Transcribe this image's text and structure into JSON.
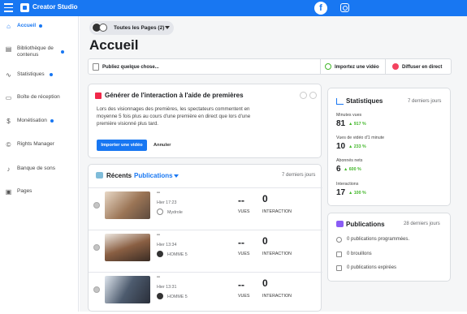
{
  "app": {
    "title": "Creator Studio"
  },
  "sidebar": {
    "items": [
      {
        "label": "Accueil"
      },
      {
        "label1": "Bibliothèque de",
        "label2": "contenus"
      },
      {
        "label": "Statistiques"
      },
      {
        "label": "Boîte de réception"
      },
      {
        "label": "Monétisation"
      },
      {
        "label": "Rights Manager"
      },
      {
        "label": "Banque de sons"
      },
      {
        "label": "Pages"
      }
    ]
  },
  "page_selector": {
    "label": "Toutes les Pages (2)"
  },
  "heading": "Accueil",
  "actions": {
    "publish": "Publiez quelque chose...",
    "import": "Importez une vidéo",
    "live": "Diffuser en direct"
  },
  "premiere": {
    "title": "Générer de l'interaction à l'aide de premières",
    "body": "Lors des visionnages des premières, les spectateurs commentent en moyenne 5 fois plus au cours d'une première en direct que lors d'une première visionné plus tard.",
    "primary": "Importer une vidéo",
    "secondary": "Annuler"
  },
  "recent": {
    "title": "Récents",
    "filter": "Publications",
    "period": "7 derniers jours",
    "rows": [
      {
        "dash": "--",
        "time": "Hier 17:23",
        "author": "Mydrole",
        "views": "--",
        "views_label": "VUES",
        "inter": "0",
        "inter_label": "INTERACTION",
        "thumb": "#c9a78a"
      },
      {
        "dash": "--",
        "time": "Hier 13:34",
        "author": "HOMME 5",
        "views": "--",
        "views_label": "VUES",
        "inter": "0",
        "inter_label": "INTERACTION",
        "thumb": "#8d6a52"
      },
      {
        "dash": "--",
        "time": "Hier 13:31",
        "author": "HOMME 5",
        "views": "--",
        "views_label": "VUES",
        "inter": "0",
        "inter_label": "INTERACTION",
        "thumb": "#6f7a8c"
      }
    ]
  },
  "stats": {
    "title": "Statistiques",
    "period": "7 derniers jours",
    "items": [
      {
        "label": "Minutes vues",
        "value": "81",
        "delta": "▲ 917 %"
      },
      {
        "label": "Vues de vidéo d'1 minute",
        "value": "10",
        "delta": "▲ 233 %"
      },
      {
        "label": "Abonnés nets",
        "value": "6",
        "delta": "▲ 600 %"
      },
      {
        "label": "Interactions",
        "value": "17",
        "delta": "▲ 100 %"
      }
    ]
  },
  "publications": {
    "title": "Publications",
    "period": "28 derniers jours",
    "items": [
      {
        "label": "0 publications programmées."
      },
      {
        "label": "0 brouillons"
      },
      {
        "label": "0 publications expirées"
      }
    ]
  },
  "colors": {
    "brand": "#1877f2",
    "positive": "#42b72a"
  }
}
